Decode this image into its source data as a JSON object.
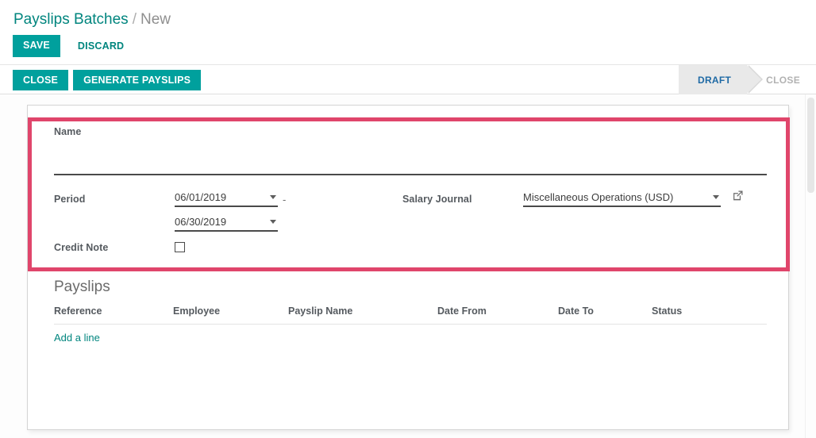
{
  "breadcrumb": {
    "root": "Payslips Batches",
    "separator": "/",
    "current": "New"
  },
  "control_panel": {
    "save_label": "SAVE",
    "discard_label": "DISCARD"
  },
  "action_row": {
    "close_label": "CLOSE",
    "generate_label": "GENERATE PAYSLIPS"
  },
  "statusbar": {
    "items": [
      {
        "label": "DRAFT",
        "active": true
      },
      {
        "label": "CLOSE",
        "active": false
      }
    ]
  },
  "form": {
    "name": {
      "label": "Name",
      "value": "",
      "placeholder": ""
    },
    "period": {
      "label": "Period",
      "date_from": "06/01/2019",
      "date_to": "06/30/2019",
      "separator": "-"
    },
    "credit_note": {
      "label": "Credit Note",
      "checked": false
    },
    "salary_journal": {
      "label": "Salary Journal",
      "value": "Miscellaneous Operations (USD)"
    }
  },
  "payslips": {
    "title": "Payslips",
    "columns": [
      "Reference",
      "Employee",
      "Payslip Name",
      "Date From",
      "Date To",
      "Status"
    ],
    "rows": [],
    "add_line_label": "Add a line"
  },
  "colors": {
    "teal": "#00a09d",
    "teal_text": "#00857e",
    "highlight_pink": "#e0456b",
    "status_active_text": "#1f6aa5",
    "label_gray": "#555a5f"
  }
}
